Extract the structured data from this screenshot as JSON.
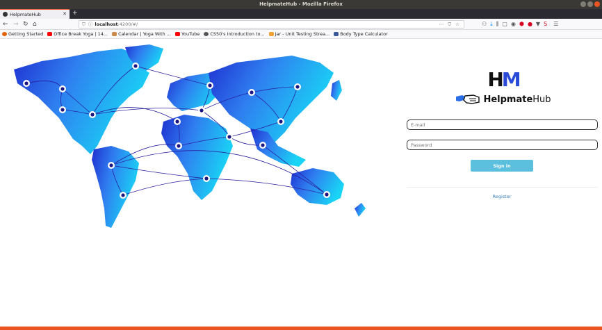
{
  "window": {
    "title": "HelpmateHub - Mozilla Firefox"
  },
  "tab": {
    "title": "HelpmateHub"
  },
  "url": {
    "host": "localhost",
    "path": ":4200/#/"
  },
  "bookmarks": [
    {
      "label": "Getting Started",
      "color": "#e66000"
    },
    {
      "label": "Office Break Yoga | 14...",
      "color": "#ff0000"
    },
    {
      "label": "Calendar | Yoga With ...",
      "color": "#c98a4b"
    },
    {
      "label": "YouTube",
      "color": "#ff0000"
    },
    {
      "label": "CS50's Introduction to...",
      "color": "#555555"
    },
    {
      "label": "Jar - Unit Testing Strea...",
      "color": "#f0a030"
    },
    {
      "label": "Body Type Calculator",
      "color": "#3b5998"
    }
  ],
  "brand": {
    "mark_h": "H",
    "mark_m": "M",
    "name_bold": "Helpmate",
    "name_light": "Hub"
  },
  "login": {
    "email_placeholder": "E-mail",
    "password_placeholder": "Password",
    "signin_label": "Sign in",
    "register_label": "Register"
  },
  "colors": {
    "accent": "#5bc0de",
    "link": "#337ab7",
    "ubuntu_orange": "#e95420"
  },
  "icons": [
    "back-icon",
    "forward-icon",
    "reload-icon",
    "home-icon",
    "shield-icon",
    "info-icon",
    "more-icon",
    "pocket-icon",
    "star-icon",
    "account-icon",
    "download-icon",
    "library-icon",
    "sidebar-icon",
    "extension-icon",
    "menu-icon"
  ]
}
